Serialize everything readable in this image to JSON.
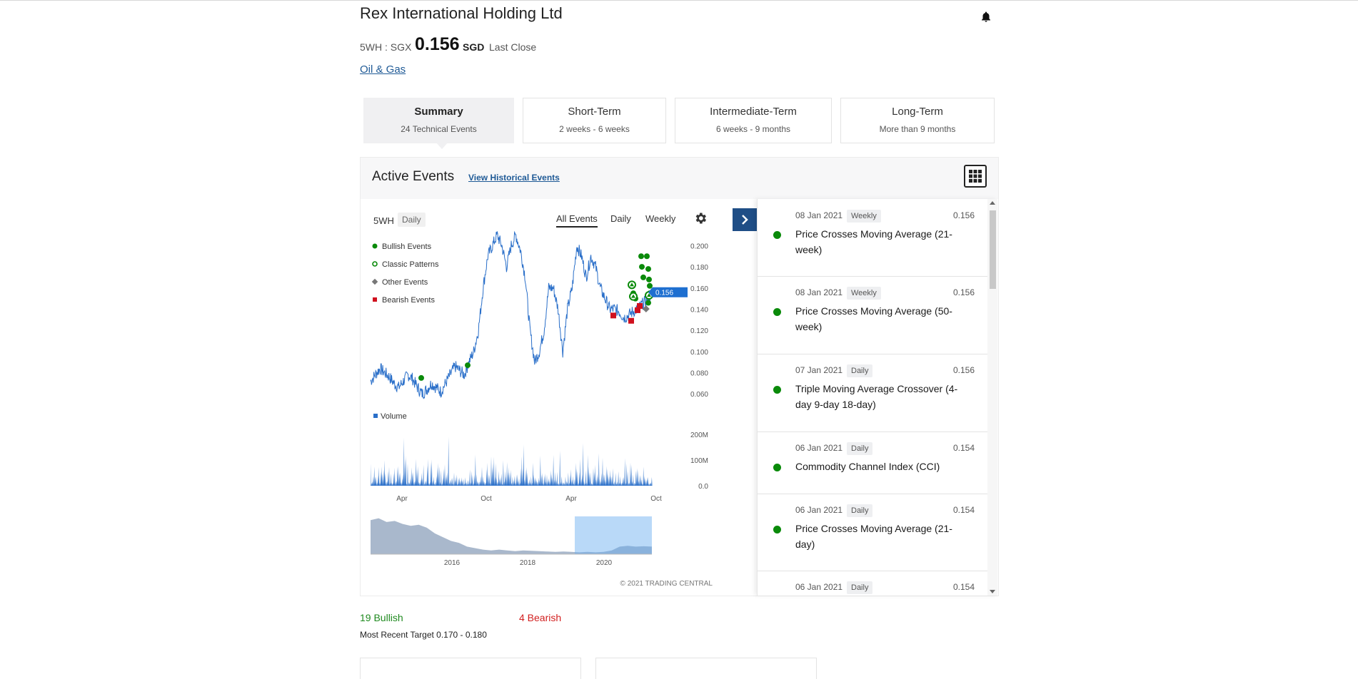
{
  "header": {
    "company": "Rex International Holding Ltd",
    "ticker": "5WH : SGX",
    "price": "0.156",
    "currency": "SGD",
    "price_label": "Last Close",
    "sector": "Oil & Gas"
  },
  "tabs": [
    {
      "label": "Summary",
      "sub": "24 Technical Events"
    },
    {
      "label": "Short-Term",
      "sub": "2 weeks - 6 weeks"
    },
    {
      "label": "Intermediate-Term",
      "sub": "6 weeks - 9 months"
    },
    {
      "label": "Long-Term",
      "sub": "More than 9 months"
    }
  ],
  "active_events": {
    "title": "Active Events",
    "history_link": "View Historical Events"
  },
  "chart": {
    "symbol": "5WH",
    "frequency": "Daily",
    "filter_tabs": [
      "All Events",
      "Daily",
      "Weekly"
    ],
    "legend": [
      "Bullish Events",
      "Classic Patterns",
      "Other Events",
      "Bearish Events"
    ],
    "volume_label": "Volume",
    "last_price_tag": "0.156",
    "copyright": "© 2021 TRADING CENTRAL",
    "colors": {
      "line": "#2a6fc9",
      "bullish": "#0a8a0a",
      "bearish": "#d0101e",
      "other": "#777777"
    }
  },
  "chart_data": {
    "type": "line",
    "title": "",
    "y_ticks": [
      "0.200",
      "0.180",
      "0.160",
      "0.140",
      "0.120",
      "0.100",
      "0.080",
      "0.060"
    ],
    "ylim": [
      0.05,
      0.205
    ],
    "x_ticks": [
      "Apr",
      "Oct",
      "Apr",
      "Oct"
    ],
    "volume_ticks": [
      "200M",
      "100M",
      "0.0"
    ],
    "navigator_ticks": [
      "2016",
      "2018",
      "2020"
    ],
    "price_series": [
      0.072,
      0.078,
      0.084,
      0.08,
      0.076,
      0.07,
      0.066,
      0.072,
      0.078,
      0.074,
      0.066,
      0.06,
      0.064,
      0.07,
      0.066,
      0.062,
      0.07,
      0.078,
      0.086,
      0.082,
      0.078,
      0.09,
      0.1,
      0.12,
      0.16,
      0.19,
      0.2,
      0.21,
      0.2,
      0.18,
      0.2,
      0.21,
      0.195,
      0.17,
      0.12,
      0.09,
      0.1,
      0.12,
      0.16,
      0.16,
      0.14,
      0.1,
      0.14,
      0.16,
      0.2,
      0.19,
      0.17,
      0.19,
      0.18,
      0.16,
      0.15,
      0.14,
      0.14,
      0.138,
      0.132,
      0.134,
      0.138,
      0.14,
      0.145,
      0.148,
      0.156
    ]
  },
  "events": [
    {
      "date": "08 Jan 2021",
      "freq": "Weekly",
      "value": "0.156",
      "name": "Price Crosses Moving Average (21-week)"
    },
    {
      "date": "08 Jan 2021",
      "freq": "Weekly",
      "value": "0.156",
      "name": "Price Crosses Moving Average (50-week)"
    },
    {
      "date": "07 Jan 2021",
      "freq": "Daily",
      "value": "0.156",
      "name": "Triple Moving Average Crossover (4-day 9-day 18-day)"
    },
    {
      "date": "06 Jan 2021",
      "freq": "Daily",
      "value": "0.154",
      "name": "Commodity Channel Index (CCI)"
    },
    {
      "date": "06 Jan 2021",
      "freq": "Daily",
      "value": "0.154",
      "name": "Price Crosses Moving Average (21-day)"
    },
    {
      "date": "06 Jan 2021",
      "freq": "Daily",
      "value": "0.154",
      "name": ""
    }
  ],
  "summary": {
    "bullish": "19 Bullish",
    "bearish": "4 Bearish",
    "target": "Most Recent Target 0.170 - 0.180"
  }
}
